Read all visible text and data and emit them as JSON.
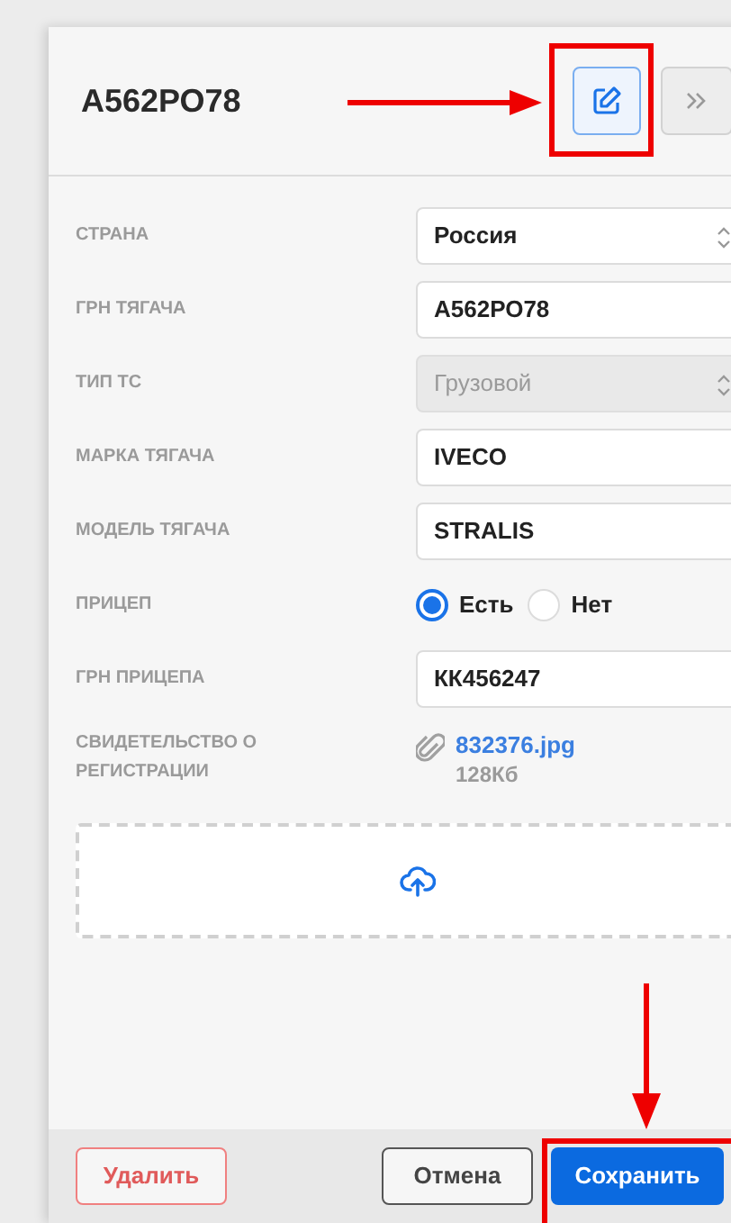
{
  "header": {
    "title": "А562РО78"
  },
  "fields": [
    {
      "kind": "select",
      "label": "СТРАНА",
      "value": "Россия",
      "disabled": false
    },
    {
      "kind": "text",
      "label": "ГРН ТЯГАЧА",
      "value": "А562РО78"
    },
    {
      "kind": "select",
      "label": "ТИП ТС",
      "value": "Грузовой",
      "disabled": true
    },
    {
      "kind": "text",
      "label": "МАРКА ТЯГАЧА",
      "value": "IVECO"
    },
    {
      "kind": "text",
      "label": "МОДЕЛЬ ТЯГАЧА",
      "value": "STRALIS"
    },
    {
      "kind": "radio",
      "label": "ПРИЦЕП",
      "options": [
        {
          "label": "Есть",
          "selected": true
        },
        {
          "label": "Нет",
          "selected": false
        }
      ]
    },
    {
      "kind": "text",
      "label": "ГРН ПРИЦЕПА",
      "value": "КК456247"
    },
    {
      "kind": "file",
      "label": "СВИДЕТЕЛЬСТВО О РЕГИСТРАЦИИ",
      "file_name": "832376.jpg",
      "file_size": "128Кб"
    }
  ],
  "footer": {
    "delete": "Удалить",
    "cancel": "Отмена",
    "save": "Сохранить"
  }
}
